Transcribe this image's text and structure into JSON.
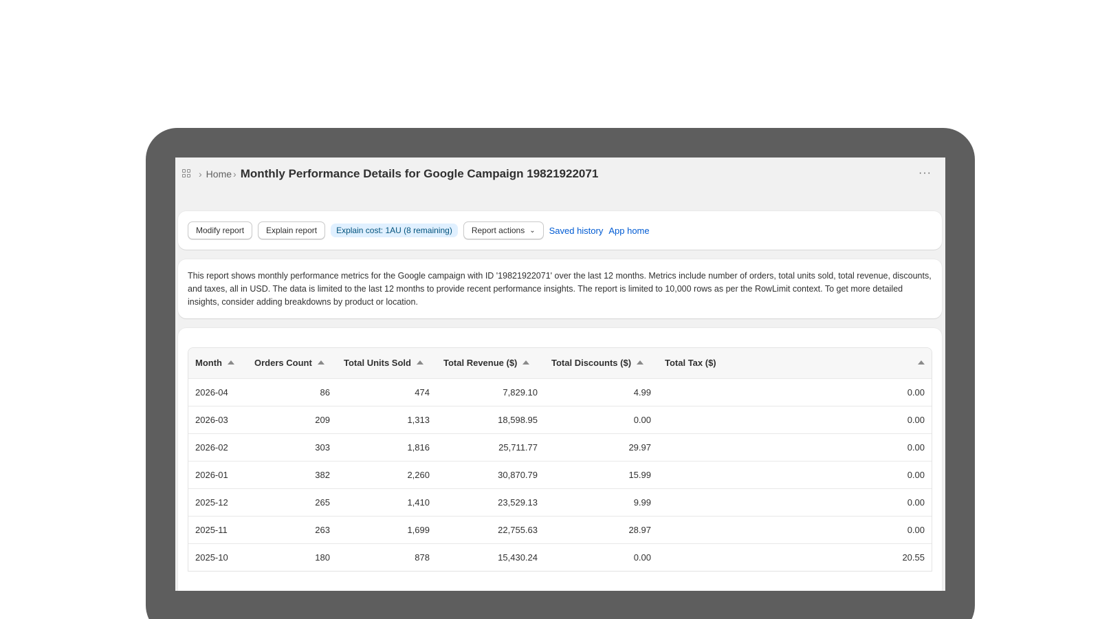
{
  "breadcrumb": {
    "home": "Home",
    "title": "Monthly Performance Details for Google Campaign 19821922071"
  },
  "toolbar": {
    "modify_label": "Modify report",
    "explain_label": "Explain report",
    "cost_badge": "Explain cost: 1AU (8 remaining)",
    "actions_label": "Report actions",
    "saved_history": "Saved history",
    "app_home": "App home"
  },
  "description": "This report shows monthly performance metrics for the Google campaign with ID '19821922071' over the last 12 months. Metrics include number of orders, total units sold, total revenue, discounts, and taxes, all in USD. The data is limited to the last 12 months to provide recent performance insights. The report is limited to 10,000 rows as per the RowLimit context. To get more detailed insights, consider adding breakdowns by product or location.",
  "table": {
    "columns": [
      "Month",
      "Orders Count",
      "Total Units Sold",
      "Total Revenue ($)",
      "Total Discounts ($)",
      "Total Tax ($)"
    ],
    "rows": [
      [
        "2026-04",
        "86",
        "474",
        "7,829.10",
        "4.99",
        "0.00"
      ],
      [
        "2026-03",
        "209",
        "1,313",
        "18,598.95",
        "0.00",
        "0.00"
      ],
      [
        "2026-02",
        "303",
        "1,816",
        "25,711.77",
        "29.97",
        "0.00"
      ],
      [
        "2026-01",
        "382",
        "2,260",
        "30,870.79",
        "15.99",
        "0.00"
      ],
      [
        "2025-12",
        "265",
        "1,410",
        "23,529.13",
        "9.99",
        "0.00"
      ],
      [
        "2025-11",
        "263",
        "1,699",
        "22,755.63",
        "28.97",
        "0.00"
      ],
      [
        "2025-10",
        "180",
        "878",
        "15,430.24",
        "0.00",
        "20.55"
      ]
    ]
  }
}
